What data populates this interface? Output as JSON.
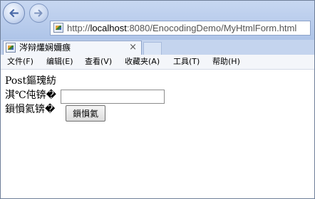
{
  "browser": {
    "address": {
      "url_prefix": "http://",
      "host": "localhost",
      "url_rest": ":8080/EnocodingDemo/MyHtmlForm.html"
    },
    "tab": {
      "title": "涔辩爜娴嬭瘯",
      "close_glyph": "×"
    },
    "menu": [
      "文件(F)",
      "编辑(E)",
      "查看(V)",
      "收藏夹(A)",
      "工具(T)",
      "帮助(H)"
    ]
  },
  "page": {
    "heading": "Post鏂瑰紡",
    "field_label": "淇℃伅锛�",
    "field_value": "",
    "submit_label": "鎻愪氦锛�",
    "submit_button": "鎻愪氦"
  },
  "icons": {
    "back": "back-arrow-icon",
    "forward": "forward-arrow-icon",
    "page": "page-icon"
  }
}
